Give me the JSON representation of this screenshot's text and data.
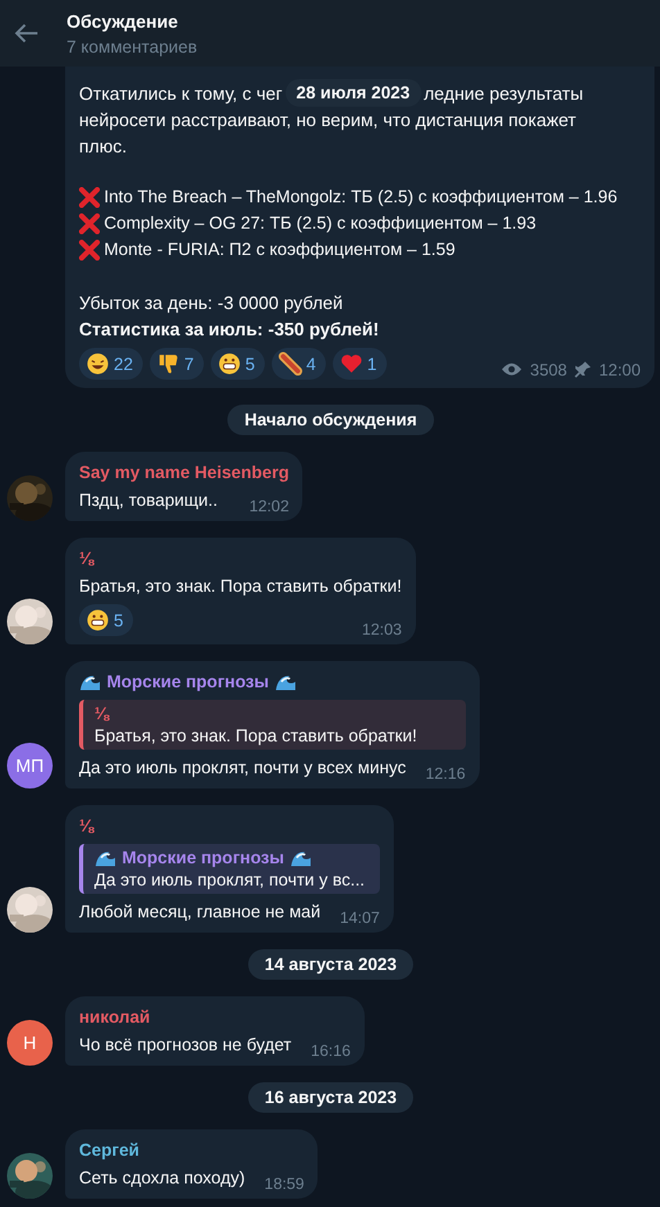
{
  "header": {
    "title": "Обсуждение",
    "subtitle": "7 комментариев"
  },
  "post": {
    "date_pill": "28 июля 2023",
    "line_left": "Откатились к тому, с чег",
    "line_right": "ледние результаты",
    "text": "нейросети расстраивают, но верим, что дистанция покажет плюс.",
    "bets": [
      {
        "text": "Into The Breach – TheMongolz: ТБ (2.5) с коэффициентом – 1.96"
      },
      {
        "text": "Complexity – OG 27: ТБ (2.5) с коэффициентом – 1.93"
      },
      {
        "text": "Monte - FURIA: П2 с коэффициентом – 1.59"
      }
    ],
    "loss": "Убыток за день: -3 0000 рублей",
    "stats": "Статистика за июль: -350 рублей!",
    "reactions": [
      {
        "kind": "rofl",
        "count": "22"
      },
      {
        "kind": "thumbs_down",
        "count": "7"
      },
      {
        "kind": "grin",
        "count": "5"
      },
      {
        "kind": "hotdog",
        "count": "4"
      },
      {
        "kind": "heart",
        "count": "1"
      }
    ],
    "views": "3508",
    "time": "12:00"
  },
  "items": [
    {
      "kind": "service",
      "text": "Начало обсуждения"
    },
    {
      "kind": "message",
      "author": "Say my name Heisenberg",
      "color": "#e35a63",
      "text": "Пздц, товарищи..",
      "time": "12:02"
    },
    {
      "kind": "message",
      "author": "⅛",
      "color": "#e35a63",
      "text": "Братья, это знак. Пора ставить обратки!",
      "reactions": [
        {
          "kind": "grin",
          "count": "5"
        }
      ],
      "time": "12:03"
    },
    {
      "kind": "message",
      "author": "Морские прогнозы",
      "wave_icons": true,
      "color": "#a685ec",
      "avatar": {
        "kind": "initials",
        "initials": "МП",
        "color": "#8b6ee6"
      },
      "reply": {
        "author": "⅛",
        "color": "#e35a63",
        "text": "Братья, это знак. Пора ставить обратки!"
      },
      "text": "Да это июль проклят, почти у всех минус",
      "time": "12:16"
    },
    {
      "kind": "message",
      "author": "⅛",
      "color": "#e35a63",
      "reply": {
        "author": "Морские прогнозы",
        "wave_icons": true,
        "color": "#a685ec",
        "text": "Да это июль проклят, почти у вс..."
      },
      "text": "Любой месяц, главное не май",
      "time": "14:07"
    },
    {
      "kind": "date",
      "text": "14 августа 2023"
    },
    {
      "kind": "message",
      "author": "николай",
      "color": "#e35a63",
      "avatar": {
        "kind": "initials",
        "initials": "Н",
        "color": "#e8624b"
      },
      "text": "Чо всё прогнозов не будет",
      "time": "16:16"
    },
    {
      "kind": "date",
      "text": "16 августа 2023"
    },
    {
      "kind": "message",
      "author": "Сергей",
      "color": "#5fb8dc",
      "text": "Сеть сдохла походу)",
      "time": "18:59"
    }
  ]
}
